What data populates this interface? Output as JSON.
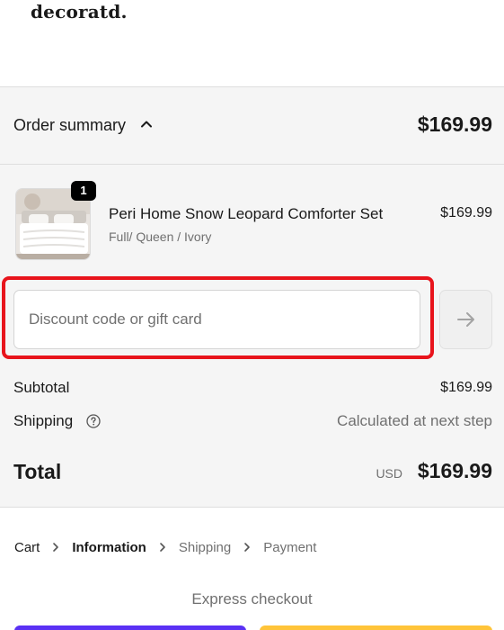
{
  "brand": {
    "logo_text": "decoratd."
  },
  "order_summary": {
    "toggle_label": "Order summary",
    "toggle_icon": "chevron-up-icon",
    "total": "$169.99"
  },
  "line_item": {
    "quantity": "1",
    "name": "Peri Home Snow Leopard Comforter Set",
    "variant": "Full/ Queen / Ivory",
    "price": "$169.99"
  },
  "discount": {
    "placeholder": "Discount code or gift card",
    "value": "",
    "apply_icon": "arrow-right-icon"
  },
  "totals": {
    "subtotal_label": "Subtotal",
    "subtotal_value": "$169.99",
    "shipping_label": "Shipping",
    "shipping_icon": "question-circle-icon",
    "shipping_value": "Calculated at next step",
    "total_label": "Total",
    "currency": "USD",
    "total_value": "$169.99"
  },
  "breadcrumb": {
    "items": [
      "Cart",
      "Information",
      "Shipping",
      "Payment"
    ],
    "active_index": 1
  },
  "express_checkout": {
    "title": "Express checkout"
  },
  "colors": {
    "highlight": "#e8141c",
    "shop_pay": "#5a31f4",
    "paypal": "#ffc439",
    "summary_bg": "#f5f5f5"
  }
}
